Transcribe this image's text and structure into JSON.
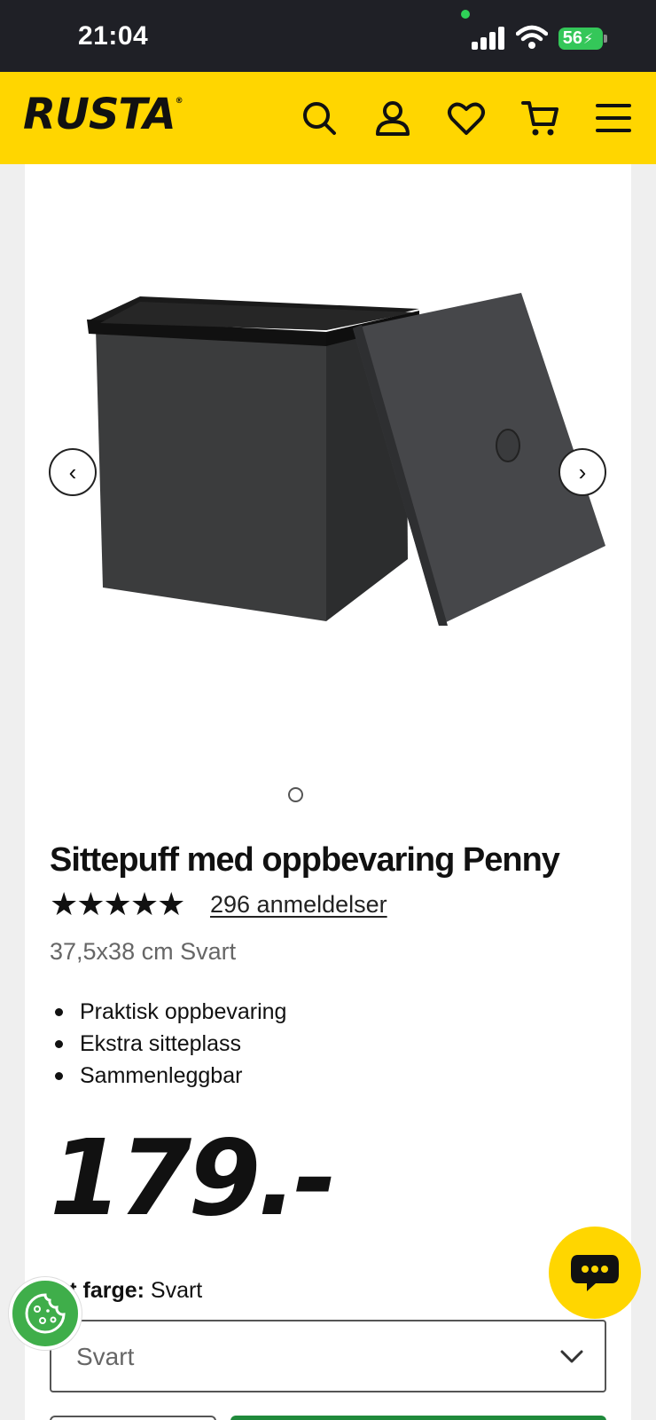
{
  "status_bar": {
    "time": "21:04",
    "battery": "56"
  },
  "header": {
    "logo": "RUSTA",
    "logo_mark": "®",
    "icons": [
      "search-icon",
      "account-icon",
      "heart-icon",
      "cart-icon",
      "menu-icon"
    ]
  },
  "gallery": {
    "image_count": 1,
    "current_index": 1
  },
  "product": {
    "title": "Sittepuff med oppbevaring Penny",
    "stars": "★★★★★",
    "rating": 5,
    "reviews_label": "296 anmeldelser",
    "variant": "37,5x38 cm Svart",
    "features": [
      "Praktisk oppbevaring",
      "Ekstra sitteplass",
      "Sammenleggbar"
    ],
    "price": "179.-"
  },
  "color": {
    "label": "lgt farge:",
    "value": "Svart",
    "selected": "Svart"
  },
  "colors": {
    "brand_yellow": "#ffd600",
    "buy_green": "#1f8a3b",
    "cookie_green": "#3fae4a"
  }
}
